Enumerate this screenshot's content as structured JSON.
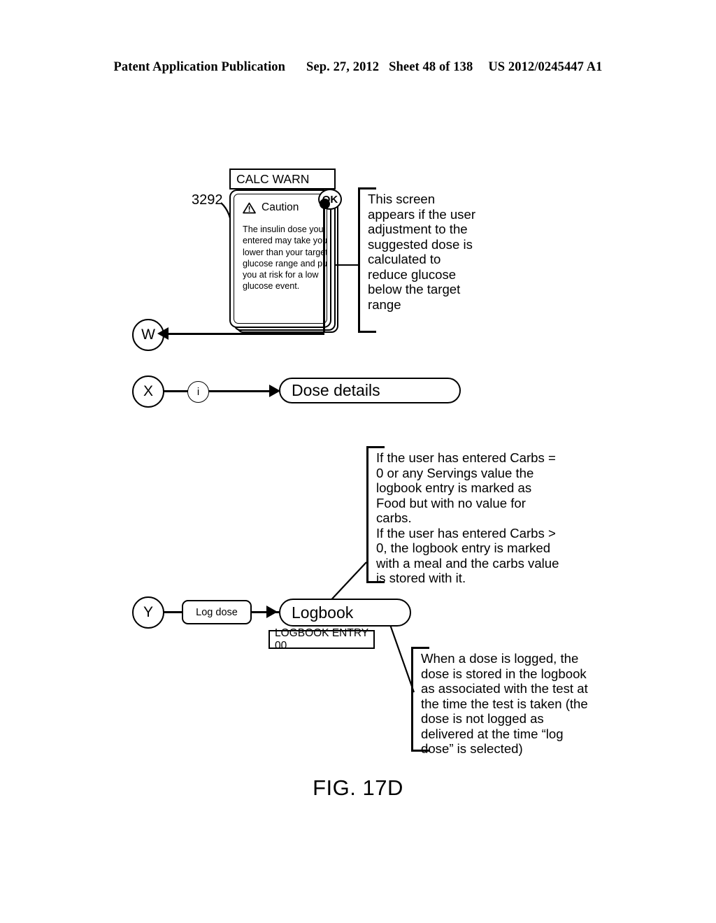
{
  "header": {
    "publication": "Patent Application Publication",
    "date": "Sep. 27, 2012",
    "sheet": "Sheet 48 of 138",
    "number": "US 2012/0245447 A1"
  },
  "figure": {
    "caption": "FIG. 17D"
  },
  "reference_numerals": {
    "dialog": "3292"
  },
  "dialog": {
    "title": "CALC WARN",
    "caution_label": "Caution",
    "warning_icon": "warning-triangle-icon",
    "body_text": "The insulin dose you entered may take you lower than your target glucose range and put you at risk for a low glucose event.",
    "ok_button": "OK"
  },
  "nodes": {
    "w": "W",
    "x": "X",
    "y": "Y",
    "info": "i"
  },
  "screens": {
    "dose_details": "Dose details",
    "logbook": "Logbook",
    "logbook_entry": "LOGBOOK ENTRY 00"
  },
  "actions": {
    "log_dose": "Log dose"
  },
  "annotations": {
    "calc_warn": {
      "lines": [
        "This screen",
        "appears if the",
        "user adjustment",
        "to the suggested",
        "dose is",
        "calculated to",
        "reduce glucose",
        "below the target",
        "range"
      ],
      "text": "This screen appears if the user adjustment to the suggested dose is calculated to reduce glucose below the target range"
    },
    "carbs": {
      "paragraph_1": "If the user has entered Carbs = 0 or any Servings value the logbook entry is marked as Food but with no value for carbs.",
      "paragraph_2": "If the user has entered Carbs > 0, the logbook entry is marked with a meal and the carbs value is stored with it."
    },
    "logging": {
      "text": "When a dose is logged, the dose is stored in the logbook as associated with the test at the time the test is taken (the dose is not logged as delivered at the time “log dose” is selected)"
    }
  },
  "colors": {
    "ink": "#000000",
    "paper": "#ffffff"
  }
}
